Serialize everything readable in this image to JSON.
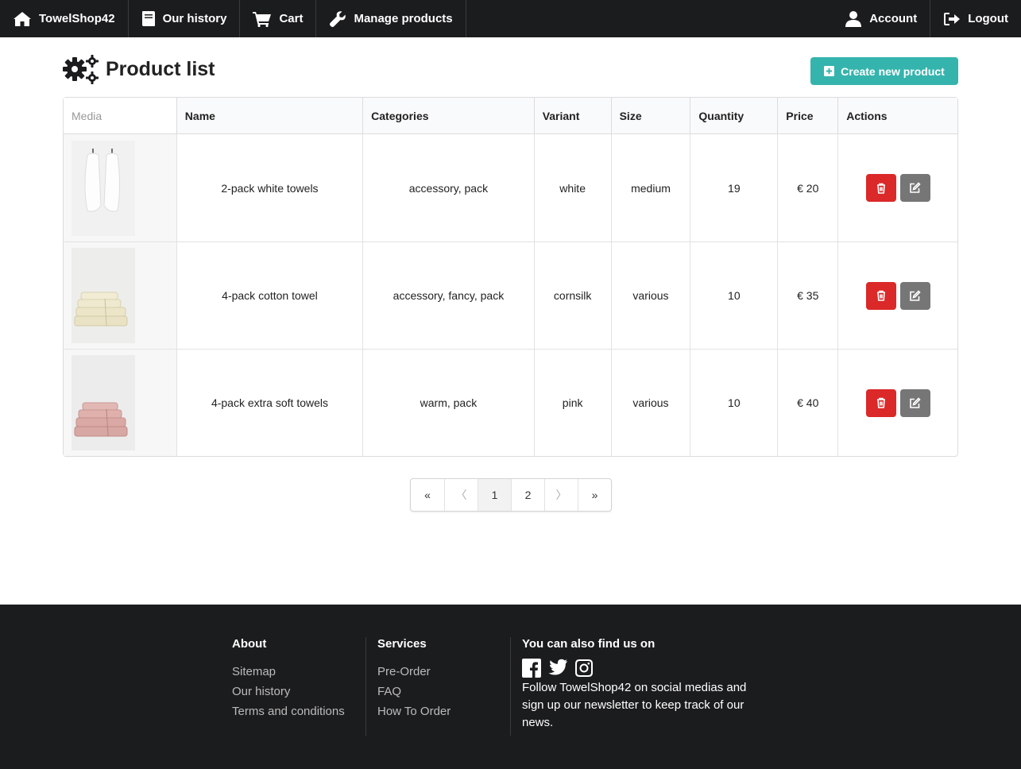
{
  "nav": {
    "brand": "TowelShop42",
    "history": "Our history",
    "cart": "Cart",
    "manage": "Manage products",
    "account": "Account",
    "logout": "Logout"
  },
  "header": {
    "title": "Product list",
    "create_button": "Create new product"
  },
  "table": {
    "headers": [
      "Media",
      "Name",
      "Categories",
      "Variant",
      "Size",
      "Quantity",
      "Price",
      "Actions"
    ],
    "rows": [
      {
        "name": "2-pack white towels",
        "categories": "accessory, pack",
        "variant": "white",
        "size": "medium",
        "quantity": "19",
        "price": "€ 20",
        "thumb_color": "#ffffff"
      },
      {
        "name": "4-pack cotton towel",
        "categories": "accessory, fancy, pack",
        "variant": "cornsilk",
        "size": "various",
        "quantity": "10",
        "price": "€ 35",
        "thumb_color": "#efe9cf"
      },
      {
        "name": "4-pack extra soft towels",
        "categories": "warm, pack",
        "variant": "pink",
        "size": "various",
        "quantity": "10",
        "price": "€ 40",
        "thumb_color": "#d7a7a3"
      }
    ]
  },
  "pagination": {
    "first": "«",
    "prev": "〈",
    "pages": [
      "1",
      "2"
    ],
    "active_page": "1",
    "next": "〉",
    "last": "»"
  },
  "footer": {
    "about": {
      "title": "About",
      "links": [
        "Sitemap",
        "Our history",
        "Terms and conditions"
      ]
    },
    "services": {
      "title": "Services",
      "links": [
        "Pre-Order",
        "FAQ",
        "How To Order"
      ]
    },
    "social": {
      "title": "You can also find us on",
      "icons": [
        "facebook-icon",
        "twitter-icon",
        "instagram-icon"
      ],
      "text": "Follow TowelShop42 on social medias and sign up our newsletter to keep track of our news."
    }
  },
  "colors": {
    "nav_bg": "#1b1c1d",
    "create_button": "#35b4ad",
    "delete_button": "#db2828",
    "edit_button": "#767676"
  }
}
